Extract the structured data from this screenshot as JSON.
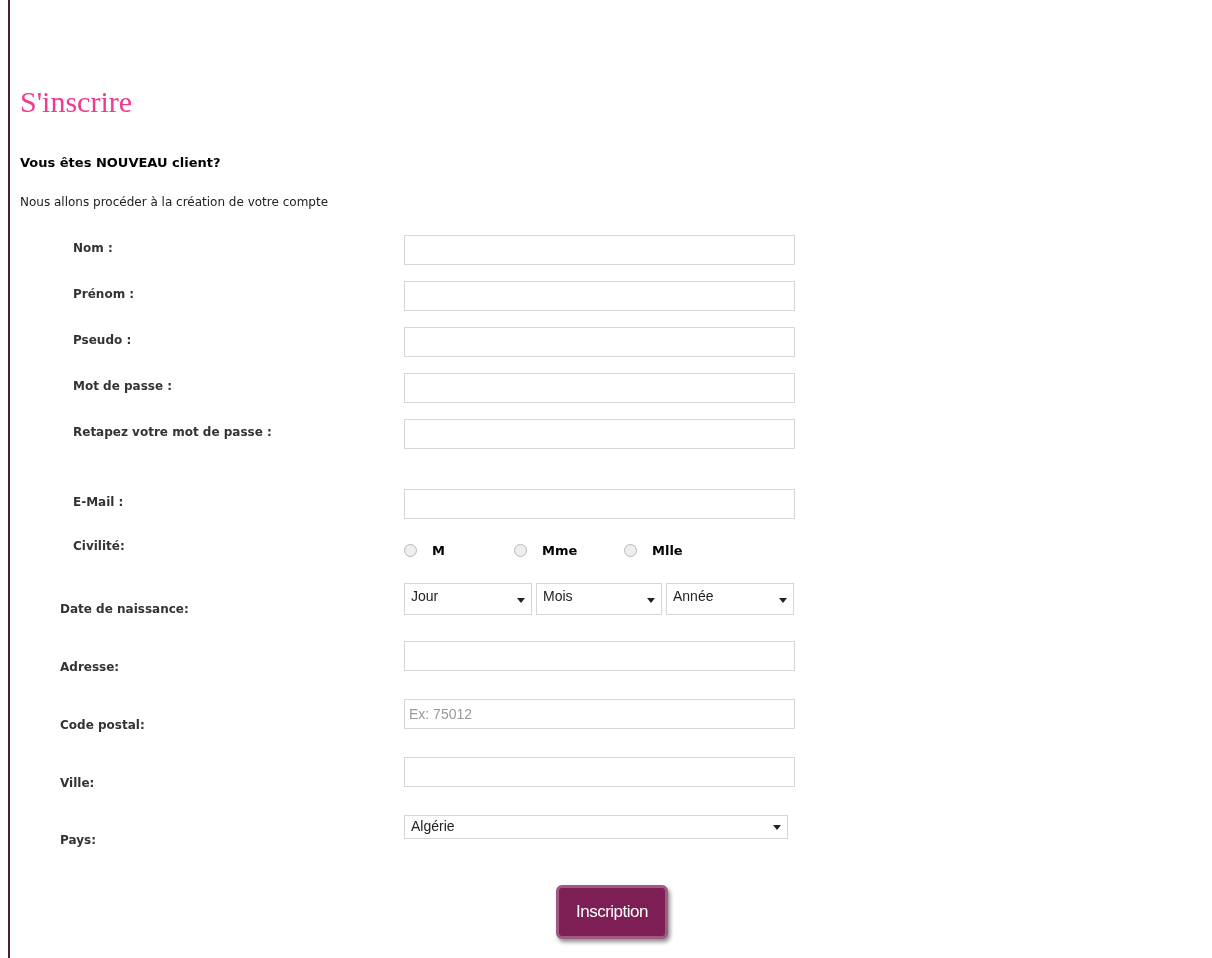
{
  "title": "S'inscrire",
  "heading": "Vous êtes NOUVEAU client?",
  "intro": "Nous allons procéder à la création de votre compte",
  "account_fields": [
    {
      "kind": "text",
      "label": "Nom :"
    },
    {
      "kind": "text",
      "label": "Prénom :"
    },
    {
      "kind": "text",
      "label": "Pseudo :"
    },
    {
      "kind": "text",
      "label": "Mot de passe :"
    },
    {
      "kind": "text",
      "label": "Retapez votre mot de passe :"
    },
    {
      "kind": "text",
      "label": "E-Mail :"
    },
    {
      "kind": "radio",
      "label": "Civilité:",
      "options": [
        {
          "label": "M",
          "selected": false
        },
        {
          "label": "Mme",
          "selected": false
        },
        {
          "label": "Mlle",
          "selected": false
        }
      ]
    }
  ],
  "address_fields": [
    {
      "kind": "date",
      "label": "Date de naissance:",
      "selects": [
        "Jour",
        "Mois",
        "Année"
      ]
    },
    {
      "kind": "text",
      "label": "Adresse:"
    },
    {
      "kind": "text",
      "label": "Code postal:",
      "placeholder": "Ex: 75012"
    },
    {
      "kind": "text",
      "label": "Ville:"
    },
    {
      "kind": "select",
      "label": "Pays:",
      "value": "Algérie"
    }
  ],
  "submit": "Inscription"
}
